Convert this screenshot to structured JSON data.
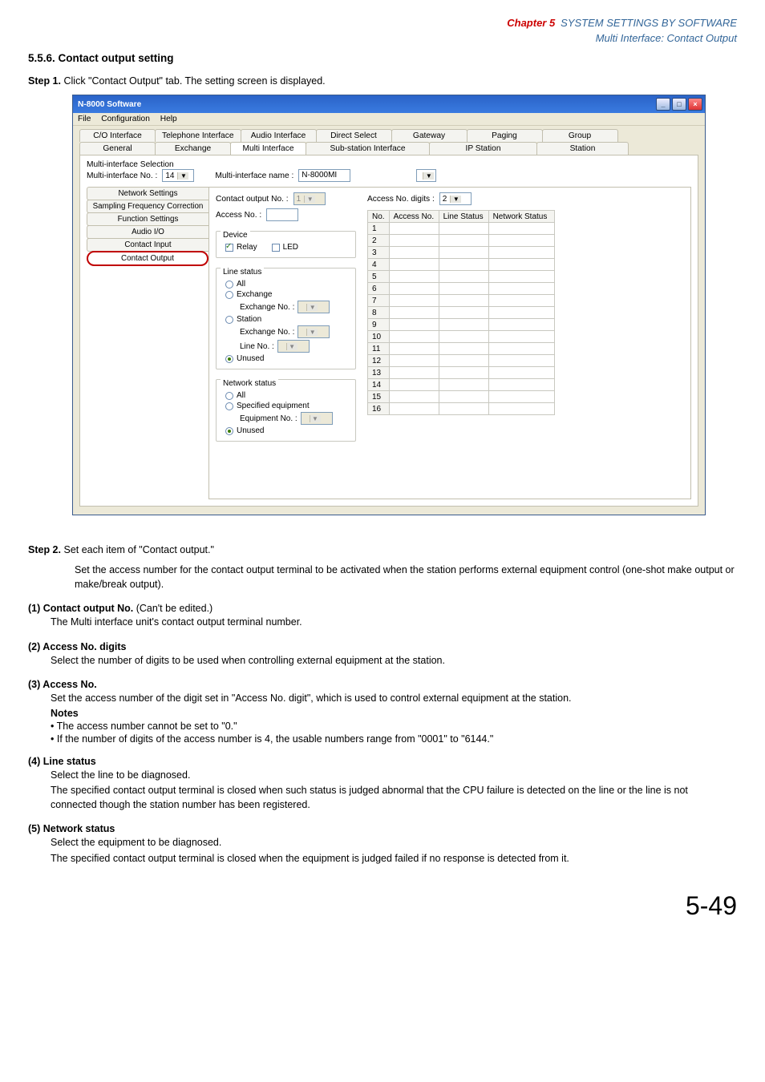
{
  "chapter": {
    "red": "Chapter 5",
    "blue": "SYSTEM SETTINGS BY SOFTWARE",
    "sub": "Multi Interface: Contact Output"
  },
  "section_num": "5.5.6. Contact output setting",
  "step1": {
    "label": "Step 1.",
    "text": "Click \"Contact Output\" tab. The setting screen is displayed."
  },
  "win": {
    "title": "N-8000 Software",
    "menu": {
      "file": "File",
      "config": "Configuration",
      "help": "Help"
    },
    "tabrow1": {
      "co": "C/O Interface",
      "tel": "Telephone Interface",
      "audio": "Audio Interface",
      "direct": "Direct Select",
      "gateway": "Gateway",
      "paging": "Paging",
      "group": "Group"
    },
    "tabrow2": {
      "general": "General",
      "exchange": "Exchange",
      "multi": "Multi Interface",
      "sub": "Sub-station Interface",
      "ip": "IP Station",
      "station": "Station"
    },
    "mi_sel_label": "Multi-interface Selection",
    "mi_no_label": "Multi-interface No. :",
    "mi_no_value": "14",
    "mi_name_label": "Multi-interface name :",
    "mi_name_value": "N-8000MI",
    "sidetabs": {
      "net": "Network Settings",
      "sfc": "Sampling Frequency Correction",
      "func": "Function Settings",
      "aio": "Audio I/O",
      "cin": "Contact Input",
      "cout": "Contact Output"
    },
    "co_no_label": "Contact output No. :",
    "co_no_value": "1",
    "acc_label": "Access No. :",
    "digits_label": "Access No. digits :",
    "digits_value": "2",
    "fs_device": {
      "legend": "Device",
      "relay": "Relay",
      "led": "LED"
    },
    "fs_line": {
      "legend": "Line status",
      "all": "All",
      "exchange": "Exchange",
      "ex_no": "Exchange No. :",
      "station": "Station",
      "st_ex_no": "Exchange No. :",
      "line_no": "Line No.        :",
      "unused": "Unused"
    },
    "fs_net": {
      "legend": "Network status",
      "all": "All",
      "spec": "Specified equipment",
      "eq_no": "Equipment No. :",
      "unused": "Unused"
    },
    "grid": {
      "no": "No.",
      "acc": "Access No.",
      "ls": "Line Status",
      "ns": "Network Status",
      "rows": [
        "1",
        "2",
        "3",
        "4",
        "5",
        "6",
        "7",
        "8",
        "9",
        "10",
        "11",
        "12",
        "13",
        "14",
        "15",
        "16"
      ]
    }
  },
  "step2": {
    "label": "Step 2.",
    "title": "Set each item of \"Contact output.\"",
    "body": "Set the access number for the contact output terminal to be activated when the station performs external equipment control (one-shot make output or make/break output)."
  },
  "d1": {
    "head": "(1)  Contact output No.",
    "paren": " (Can't be edited.)",
    "body": "The Multi interface unit's contact output terminal number."
  },
  "d2": {
    "head": "(2)  Access No. digits",
    "body": "Select the number of digits to be used when controlling external equipment at the station."
  },
  "d3": {
    "head": "(3)  Access No.",
    "body": "Set the access number of the digit set in \"Access No. digit\", which is used to control external equipment at the station.",
    "notes": "Notes",
    "b1": "• The access number cannot be set to \"0.\"",
    "b2": "• If the number of digits of the access number is 4, the usable numbers range from \"0001\" to \"6144.\""
  },
  "d4": {
    "head": "(4)  Line status",
    "l1": "Select the line to be diagnosed.",
    "l2": "The specified contact output terminal is closed when such status is judged abnormal that the CPU failure is detected on the line or the line is not connected though the station number has been registered."
  },
  "d5": {
    "head": "(5)  Network status",
    "l1": "Select the equipment to be diagnosed.",
    "l2": "The specified contact output terminal is closed when the equipment is judged failed if no response is detected from it."
  },
  "pagenum": "5-49"
}
